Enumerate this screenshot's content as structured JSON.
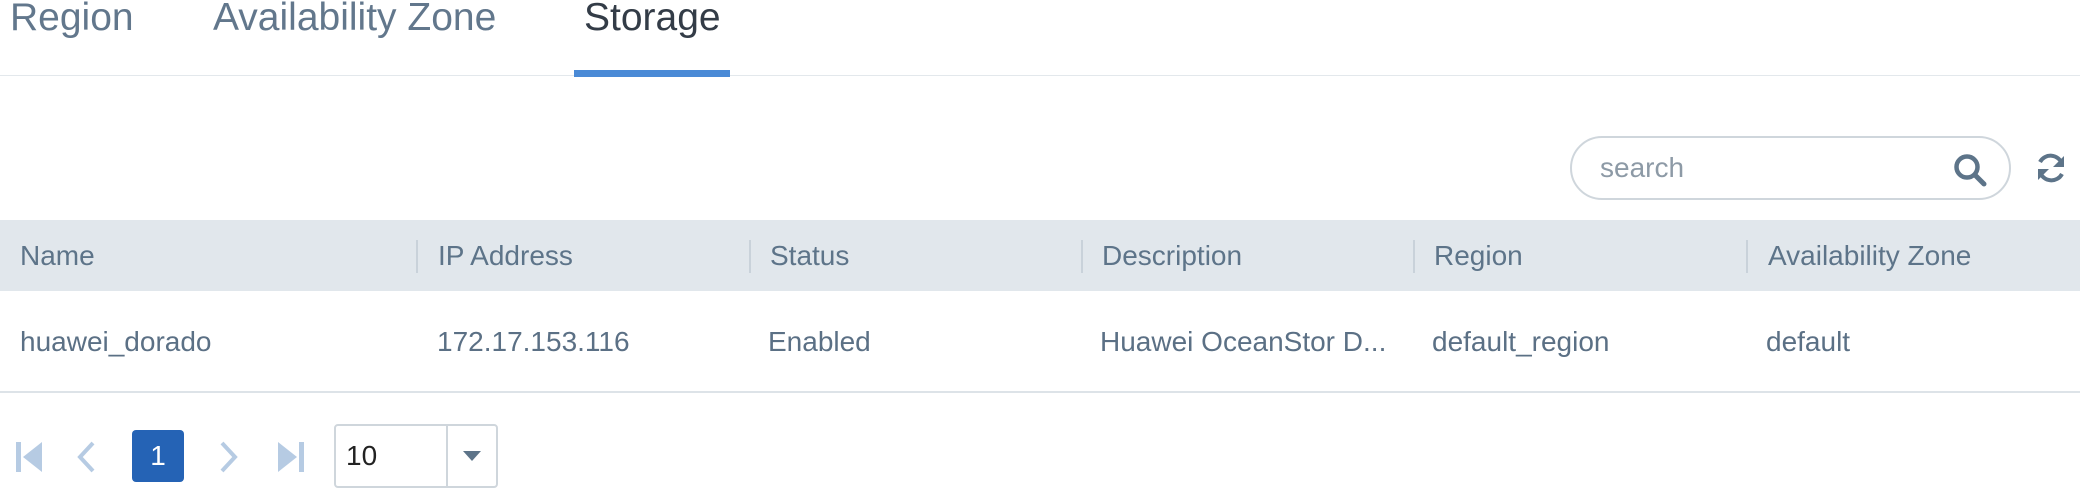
{
  "tabs": [
    {
      "label": "Region",
      "active": false
    },
    {
      "label": "Availability Zone",
      "active": false
    },
    {
      "label": "Storage",
      "active": true
    }
  ],
  "toolbar": {
    "search_placeholder": "search",
    "search_icon": "search-icon",
    "refresh_icon": "refresh-icon"
  },
  "table": {
    "columns": [
      "Name",
      "IP Address",
      "Status",
      "Description",
      "Region",
      "Availability Zone"
    ],
    "rows": [
      [
        "huawei_dorado",
        "172.17.153.116",
        "Enabled",
        "Huawei OceanStor D...",
        "default_region",
        "default"
      ]
    ]
  },
  "pagination": {
    "current_page": "1",
    "page_size": "10",
    "icons": [
      "first-page-icon",
      "prev-page-icon",
      "next-page-icon",
      "last-page-icon",
      "caret-down-icon"
    ]
  },
  "colors": {
    "accent": "#4a8ad6",
    "active_page": "#2563b5",
    "header_bg": "#e1e7ec"
  }
}
